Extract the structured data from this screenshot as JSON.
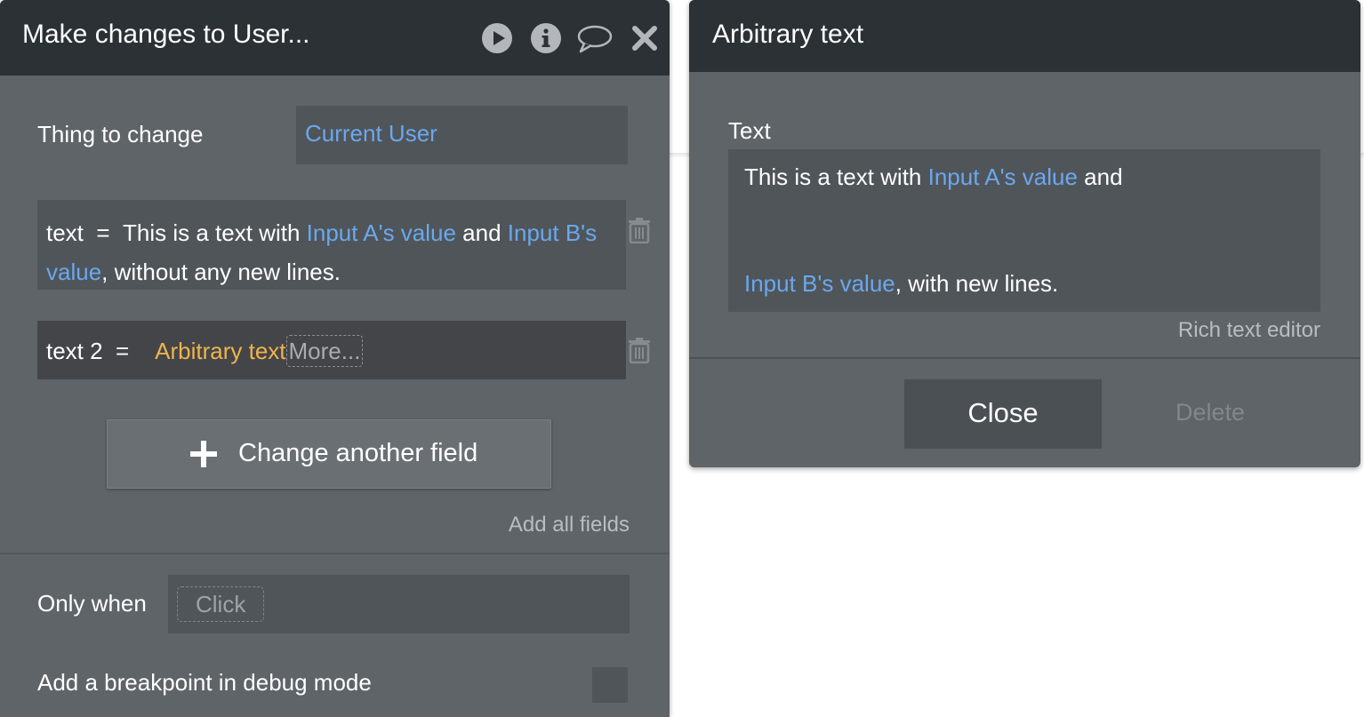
{
  "left_panel": {
    "title": "Make changes to User...",
    "thing_to_change": {
      "label": "Thing to change",
      "value": "Current User"
    },
    "fields": [
      {
        "name": "text",
        "operator": "=",
        "parts": [
          {
            "text": "This is a text with ",
            "type": "plain"
          },
          {
            "text": "Input A's value",
            "type": "dynamic"
          },
          {
            "text": " and ",
            "type": "plain"
          },
          {
            "text": "Input B's value",
            "type": "dynamic"
          },
          {
            "text": ", without any new lines.",
            "type": "plain"
          }
        ]
      },
      {
        "name": "text 2",
        "operator": "=",
        "value": "Arbitrary text",
        "more": "More..."
      }
    ],
    "change_another_field": "Change another field",
    "add_all_fields": "Add all fields",
    "only_when": {
      "label": "Only when",
      "placeholder": "Click"
    },
    "breakpoint": {
      "label": "Add a breakpoint in debug mode",
      "checked": false
    }
  },
  "right_panel": {
    "title": "Arbitrary text",
    "text_label": "Text",
    "line1": [
      {
        "text": "This is a text with ",
        "type": "plain"
      },
      {
        "text": "Input A's value",
        "type": "dynamic"
      },
      {
        "text": " and",
        "type": "plain"
      }
    ],
    "line2": [
      {
        "text": "Input B's value",
        "type": "dynamic"
      },
      {
        "text": ", with new lines.",
        "type": "plain"
      }
    ],
    "rich_text_editor": "Rich text editor",
    "close": "Close",
    "delete": "Delete"
  },
  "icons": [
    "play-icon",
    "info-icon",
    "comment-icon",
    "close-icon",
    "trash-icon",
    "plus-icon"
  ],
  "colors": {
    "header": "#2b3134",
    "panel": "#5f6469",
    "input": "#50555a",
    "dynamic_text": "#6aa8ec",
    "arbitrary_text": "#f0b44c"
  }
}
